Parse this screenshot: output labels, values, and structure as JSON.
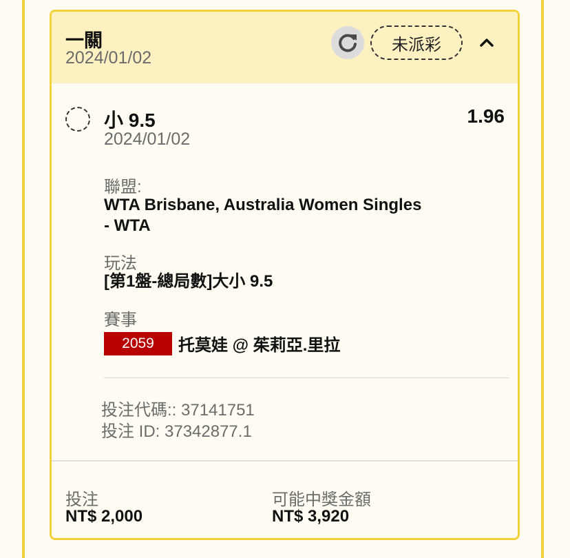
{
  "bet": {
    "type_title": "一關",
    "date": "2024/01/02",
    "status": "未派彩",
    "icons": {
      "refresh": "refresh-icon",
      "collapse": "chevron-up-icon"
    }
  },
  "selection": {
    "name": "小 9.5",
    "odds": "1.96",
    "date": "2024/01/02",
    "league_label": "聯盟:",
    "league_line1": "WTA Brisbane, Australia Women Singles",
    "league_line2": "- WTA",
    "market_label": "玩法",
    "market_value": "[第1盤-總局數]大小 9.5",
    "event_label": "賽事",
    "event_id": "2059",
    "event_teams": "托莫娃 @ 茱莉亞.里拉",
    "badge_color": "#b80000"
  },
  "codes": {
    "bet_code": "投注代碼:: 37141751",
    "bet_id": "投注 ID: 37342877.1"
  },
  "footer": {
    "stake_label": "投注",
    "stake_value": "NT$ 2,000",
    "payout_label": "可能中獎金額",
    "payout_value": "NT$ 3,920"
  },
  "colors": {
    "accent_border": "#f2d23a",
    "header_bg": "#fdf1c2",
    "page_bg": "#fffdf3"
  }
}
